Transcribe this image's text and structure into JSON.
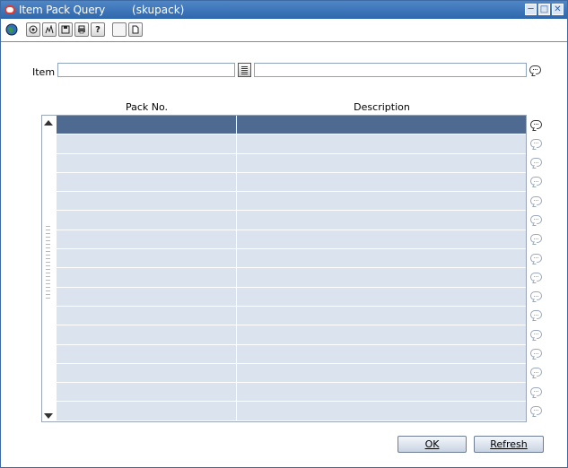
{
  "window": {
    "title": "Item Pack Query",
    "subtitle": "(skupack)",
    "controls": [
      "minimize-icon",
      "maximize-icon",
      "close-icon"
    ]
  },
  "toolbar": {
    "buttons": [
      "globe-icon",
      "action-icon",
      "edit-icon",
      "save-icon",
      "print-icon",
      "help-icon",
      "blank-window-icon",
      "new-document-icon"
    ]
  },
  "form": {
    "item_label": "Item",
    "item_value": "",
    "item_description_value": ""
  },
  "grid": {
    "columns": [
      "Pack No.",
      "Description"
    ],
    "rows": [
      {
        "pack_no": "",
        "description": "",
        "selected": true
      },
      {
        "pack_no": "",
        "description": ""
      },
      {
        "pack_no": "",
        "description": ""
      },
      {
        "pack_no": "",
        "description": ""
      },
      {
        "pack_no": "",
        "description": ""
      },
      {
        "pack_no": "",
        "description": ""
      },
      {
        "pack_no": "",
        "description": ""
      },
      {
        "pack_no": "",
        "description": ""
      },
      {
        "pack_no": "",
        "description": ""
      },
      {
        "pack_no": "",
        "description": ""
      },
      {
        "pack_no": "",
        "description": ""
      },
      {
        "pack_no": "",
        "description": ""
      },
      {
        "pack_no": "",
        "description": ""
      },
      {
        "pack_no": "",
        "description": ""
      },
      {
        "pack_no": "",
        "description": ""
      },
      {
        "pack_no": "",
        "description": ""
      }
    ]
  },
  "buttons": {
    "ok": "OK",
    "refresh": "Refresh"
  },
  "colors": {
    "titlebar": "#2f67ad",
    "row_fill": "#dbe3ef",
    "selected_row": "#4f6a90"
  }
}
